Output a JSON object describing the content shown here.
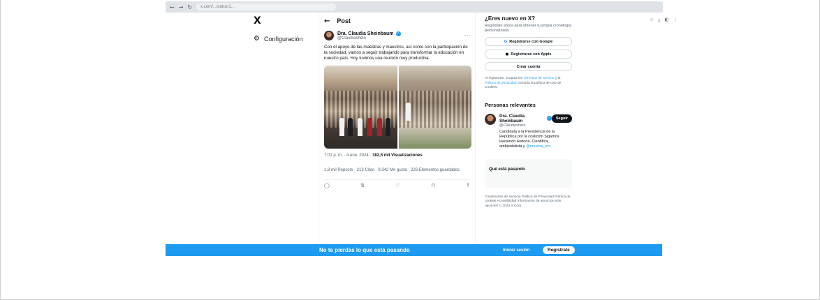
{
  "browser": {
    "nav_buttons": [
      "←",
      "→",
      "↻"
    ],
    "url": "x.com/...status/1...",
    "right_icons": [
      "☆",
      "⤓",
      "◐",
      "⋮"
    ]
  },
  "leftnav": {
    "logo": "X",
    "settings_label": "Configuración"
  },
  "post": {
    "header_title": "Post",
    "author_name": "Dra. Claudia Sheinbaum",
    "author_handle": "@Claudiashein",
    "text": "Con el apoyo de las maestras y maestros, así como con la participación de la sociedad, vamos a seguir trabajando para transformar la educación en nuestro país. Hoy tuvimos una reunión muy productiva.",
    "timestamp": "7:01 p. m. · 4 ene. 2024",
    "views": "182,5 mil Visualizaciones",
    "stats": "1,8 mil Reposts  ·  213 Citas  ·  9.342 Me gusta  ·  226 Elementos guardados",
    "actions": {
      "reply": "◯",
      "repost": "⇅",
      "like": "♡",
      "bookmark": "⊓",
      "share": "↑"
    }
  },
  "signup_card": {
    "title": "¿Eres nuevo en X?",
    "subtitle": "Regístrate ahora para obtener tu propia cronología personalizada.",
    "google": "Registrarse con Google",
    "apple": "Registrarse con Apple",
    "create": "Crear cuenta",
    "legal_prefix": "Al registrarte, aceptas los ",
    "legal_terms": "Términos de servicio",
    "legal_mid": " y la ",
    "legal_privacy": "Política de privacidad",
    "legal_suffix": ", incluida la política de Uso de Cookies."
  },
  "relevant": {
    "title": "Personas relevantes",
    "name": "Dra. Claudia Sheinbaum",
    "handle": "@Claudiashein",
    "follow": "Seguir",
    "bio": "Candidata a la Presidencia de la República por la coalición Sigamos Haciendo Historia. Científica, ambientalista y ",
    "bio_link": "@morena_mx"
  },
  "happening": {
    "title": "Qué está pasando"
  },
  "footer": {
    "links": "Condiciones de Servicio  Política de Privacidad  Política de cookies  Accesibilidad  Información de anuncios  Más opciones  © 2024 X Corp."
  },
  "banner": {
    "text": "No te pierdas lo que está pasando",
    "login": "Iniciar sesión",
    "signup": "Regístrate"
  }
}
